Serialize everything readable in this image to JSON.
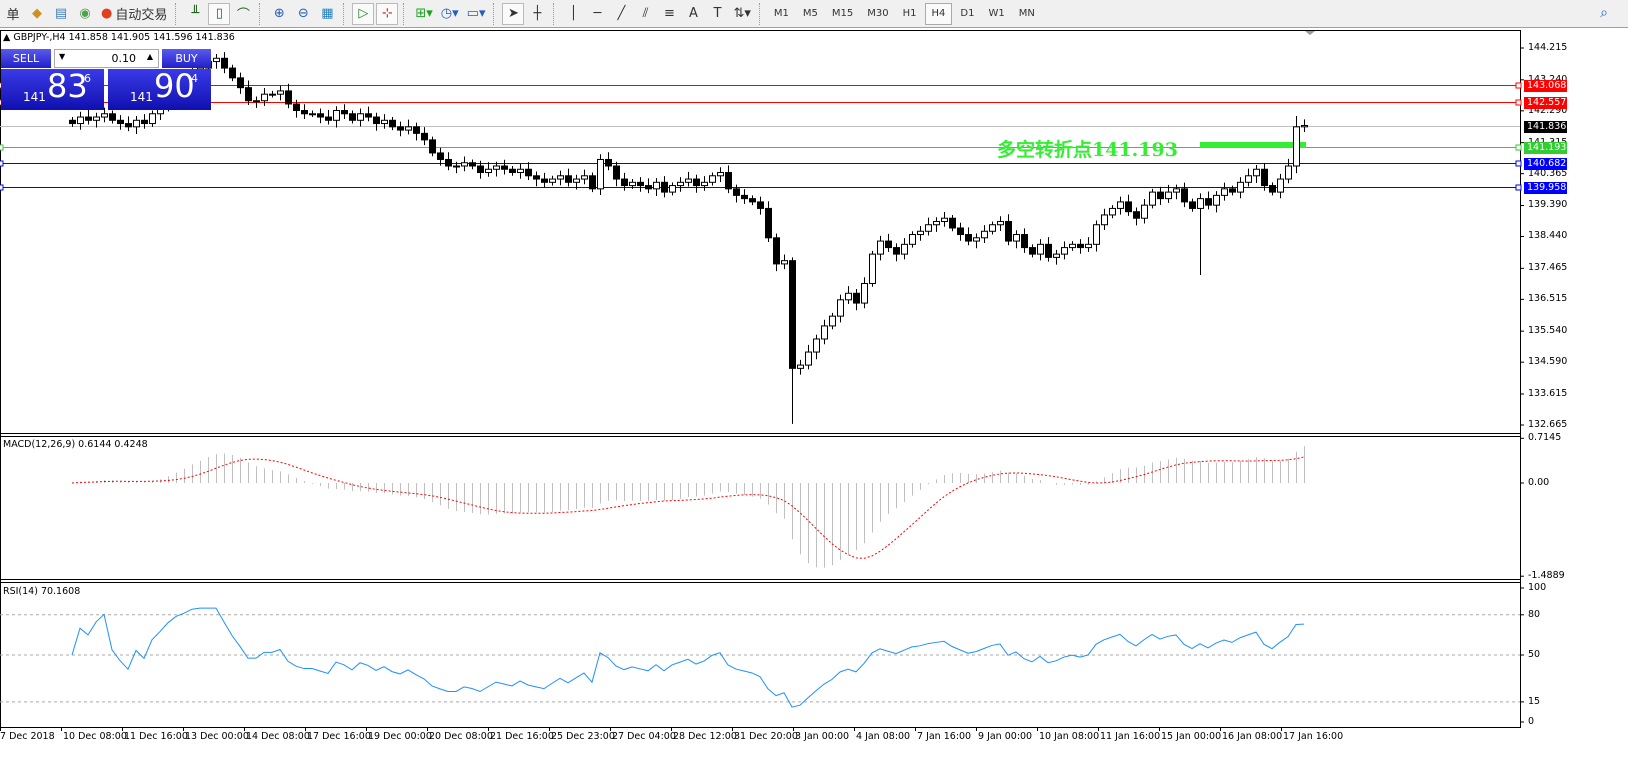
{
  "toolbar": {
    "left_items": [
      {
        "label": "单",
        "icon": "menu-char"
      },
      {
        "icon": "folder-icon"
      },
      {
        "icon": "profiles-icon"
      },
      {
        "icon": "signal-icon"
      }
    ],
    "auto_trading_label": "自动交易",
    "chart_tools": [
      "bar-chart-icon",
      "candlestick-icon",
      "line-chart-icon",
      "zoom-in-icon",
      "zoom-out-icon",
      "tile-windows-icon",
      "autoscroll-icon",
      "chart-shift-icon",
      "indicators-icon",
      "periods-icon",
      "templates-icon",
      "cursor-icon",
      "crosshair-icon",
      "vertical-line-icon",
      "horizontal-line-icon",
      "trendline-icon",
      "equidistant-channel-icon",
      "fibonacci-icon",
      "text-icon",
      "text-label-icon",
      "arrows-icon"
    ],
    "timeframes": [
      "M1",
      "M5",
      "M15",
      "M30",
      "H1",
      "H4",
      "D1",
      "W1",
      "MN"
    ],
    "active_timeframe": "H4"
  },
  "chart": {
    "symbol_line": "GBPJPY-,H4  141.858 141.905 141.596 141.836",
    "trade_panel": {
      "sell_label": "SELL",
      "buy_label": "BUY",
      "lot": "0.10",
      "sell_prefix": "141",
      "sell_big": "83",
      "sell_sup": "6",
      "buy_prefix": "141",
      "buy_big": "90",
      "buy_sup": "4"
    },
    "annotation": "多空转折点141.193",
    "price_axis": [
      "144.215",
      "143.240",
      "142.290",
      "141.315",
      "140.365",
      "139.390",
      "138.440",
      "137.465",
      "136.515",
      "135.540",
      "134.590",
      "133.615",
      "132.665"
    ],
    "levels": [
      {
        "price": 143.068,
        "label": "143.068",
        "color": "#ff0000"
      },
      {
        "price": 142.557,
        "label": "142.557",
        "color": "#ff0000"
      },
      {
        "price": 141.836,
        "label": "141.836",
        "color": "#000000",
        "line": "#c0c0c0"
      },
      {
        "price": 141.193,
        "label": "141.193",
        "color": "#33cc33"
      },
      {
        "price": 140.682,
        "label": "140.682",
        "color": "#0000ff"
      },
      {
        "price": 139.958,
        "label": "139.958",
        "color": "#0000ff"
      }
    ],
    "time_axis": [
      "7 Dec 2018",
      "10 Dec 08:00",
      "11 Dec 16:00",
      "13 Dec 00:00",
      "14 Dec 08:00",
      "17 Dec 16:00",
      "19 Dec 00:00",
      "20 Dec 08:00",
      "21 Dec 16:00",
      "25 Dec 23:00",
      "27 Dec 04:00",
      "28 Dec 12:00",
      "31 Dec 20:00",
      "3 Jan 00:00",
      "4 Jan 08:00",
      "7 Jan 16:00",
      "9 Jan 00:00",
      "10 Jan 08:00",
      "11 Jan 16:00",
      "15 Jan 00:00",
      "16 Jan 08:00",
      "17 Jan 16:00"
    ],
    "closes": [
      141.9,
      142.1,
      142.0,
      142.1,
      142.2,
      142.0,
      141.9,
      141.8,
      142.0,
      141.9,
      142.2,
      142.4,
      142.7,
      143.0,
      143.2,
      143.5,
      143.6,
      143.8,
      143.9,
      143.6,
      143.3,
      143.0,
      142.6,
      142.6,
      142.8,
      142.8,
      142.9,
      142.5,
      142.3,
      142.2,
      142.2,
      142.1,
      142.0,
      142.3,
      142.2,
      142.0,
      142.2,
      142.1,
      141.9,
      142.0,
      141.8,
      141.7,
      141.8,
      141.6,
      141.4,
      141.0,
      140.8,
      140.6,
      140.6,
      140.7,
      140.6,
      140.4,
      140.5,
      140.6,
      140.5,
      140.4,
      140.5,
      140.3,
      140.2,
      140.1,
      140.2,
      140.3,
      140.1,
      140.2,
      140.3,
      139.9,
      140.8,
      140.6,
      140.2,
      140.0,
      140.1,
      140.0,
      139.9,
      140.1,
      139.8,
      140.0,
      140.1,
      140.2,
      140.0,
      140.1,
      140.3,
      140.4,
      139.9,
      139.7,
      139.6,
      139.5,
      139.3,
      138.4,
      137.6,
      137.7,
      134.4,
      134.5,
      134.9,
      135.3,
      135.7,
      136.0,
      136.5,
      136.7,
      136.4,
      137.0,
      137.9,
      138.3,
      138.1,
      137.9,
      138.2,
      138.5,
      138.6,
      138.8,
      138.9,
      139.0,
      138.7,
      138.5,
      138.3,
      138.4,
      138.6,
      138.8,
      138.9,
      138.3,
      138.5,
      138.1,
      137.9,
      138.2,
      137.8,
      137.9,
      138.1,
      138.2,
      138.1,
      138.2,
      138.8,
      139.1,
      139.3,
      139.5,
      139.2,
      139.0,
      139.4,
      139.8,
      139.6,
      139.8,
      139.9,
      139.5,
      139.3,
      139.6,
      139.4,
      139.7,
      139.9,
      139.8,
      140.1,
      140.3,
      140.5,
      140.0,
      139.8,
      140.2,
      140.6,
      141.8,
      141.84
    ],
    "extremes": {
      "90": {
        "low": 132.7
      },
      "141": {
        "low": 137.26
      },
      "153": {
        "high": 142.13
      }
    }
  },
  "macd": {
    "label": "MACD(12,26,9) 0.6144 0.4248",
    "axis": [
      "0.7145",
      "0.00",
      "-1.4889"
    ],
    "signal_color": "#ff0000",
    "hist_color": "#c0c0c0"
  },
  "rsi": {
    "label": "RSI(14) 70.1608",
    "axis": [
      "100",
      "80",
      "50",
      "15",
      "0"
    ],
    "line_color": "#1e90ff"
  }
}
